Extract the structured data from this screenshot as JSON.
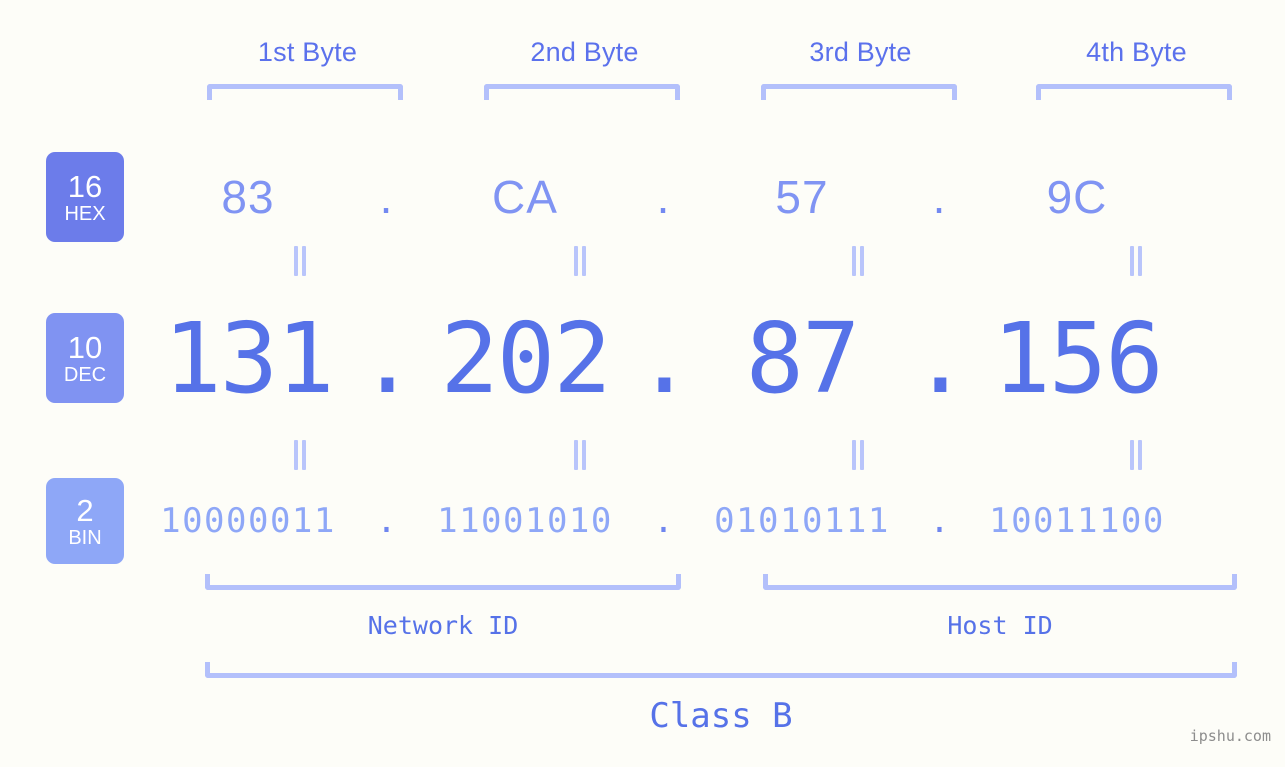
{
  "header": {
    "byte_labels": [
      "1st Byte",
      "2nd Byte",
      "3rd Byte",
      "4th Byte"
    ]
  },
  "bases": [
    {
      "num": "16",
      "name": "HEX",
      "color": "#6c7cea"
    },
    {
      "num": "10",
      "name": "DEC",
      "color": "#8093f2"
    },
    {
      "num": "2",
      "name": "BIN",
      "color": "#8ea7f7"
    }
  ],
  "rows": {
    "hex": {
      "octets": [
        "83",
        "CA",
        "57",
        "9C"
      ],
      "separator": "."
    },
    "dec": {
      "octets": [
        "131",
        "202",
        "87",
        "156"
      ],
      "separator": "."
    },
    "bin": {
      "octets": [
        "10000011",
        "11001010",
        "01010111",
        "10011100"
      ],
      "separator": "."
    }
  },
  "equality_mark": "=",
  "footer": {
    "network_id_label": "Network ID",
    "host_id_label": "Host ID",
    "class_label": "Class B"
  },
  "watermark": "ipshu.com",
  "colors": {
    "background": "#fdfdf8",
    "bracket": "#b3c0fb",
    "hex_text": "#8094f3",
    "dec_text": "#5672e8",
    "bin_text": "#8ea7f7",
    "byte_label": "#5b71ec",
    "equality": "#b9c5fb",
    "watermark": "#8d8d8d"
  }
}
